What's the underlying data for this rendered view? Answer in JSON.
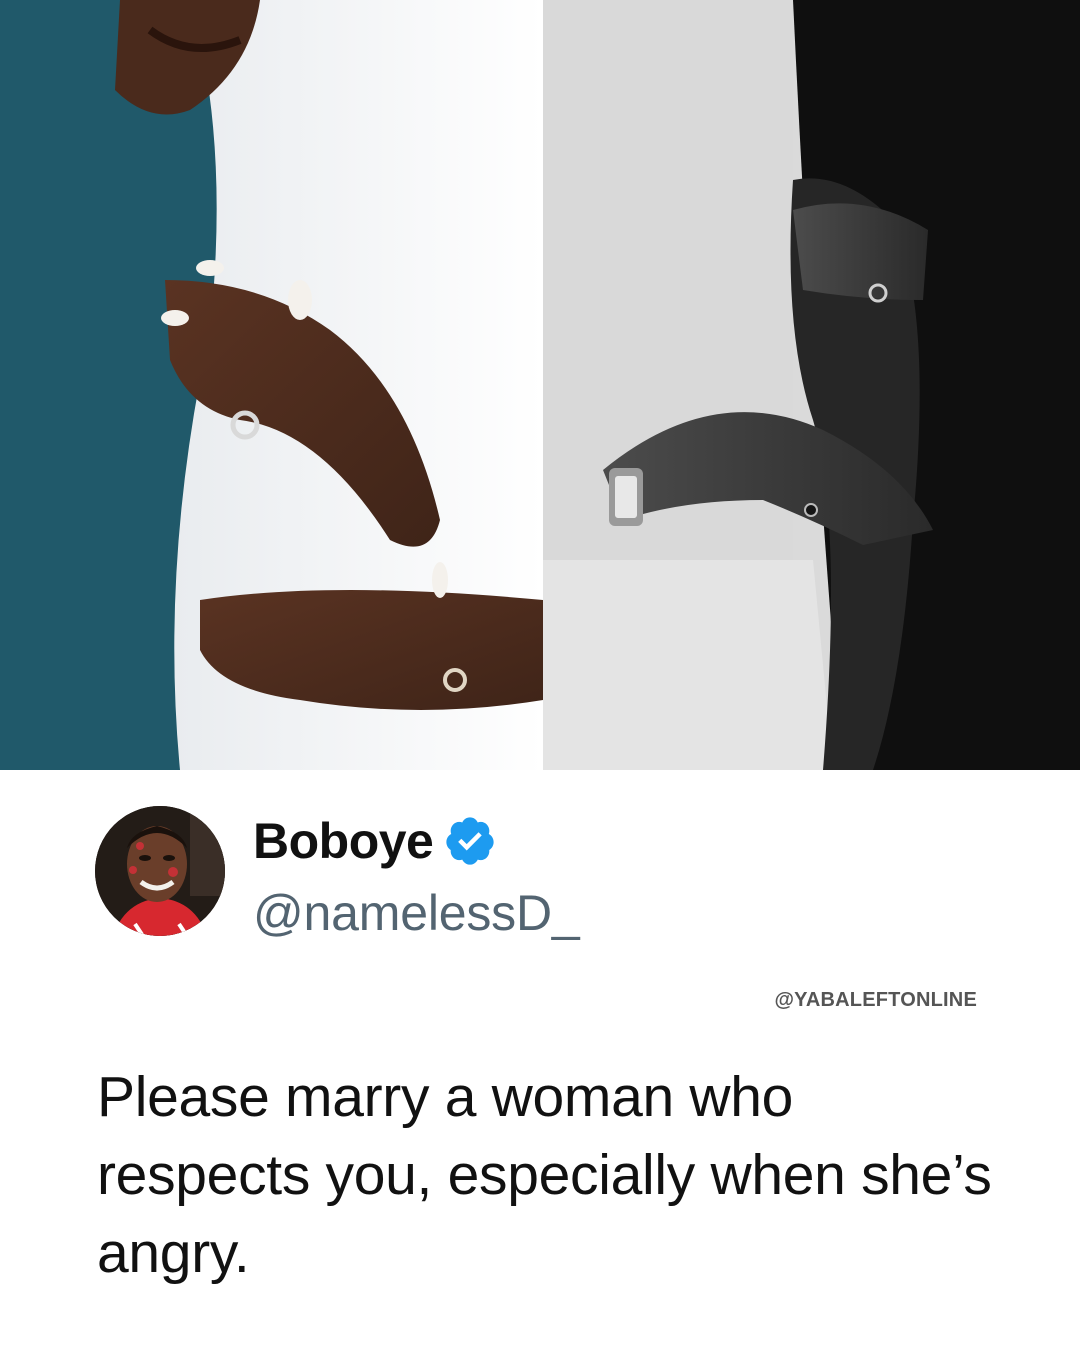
{
  "tweet": {
    "display_name": "Boboye",
    "handle": "@namelessD_",
    "verified": true,
    "verified_icon": "verified-badge-icon",
    "text": "Please marry a woman who respects you, especially when she’s angry."
  },
  "watermark": "@YABALEFTONLINE",
  "colors": {
    "verified_badge": "#1d9bf0",
    "handle_text": "#536471",
    "body_text": "#111111",
    "background": "#ffffff"
  }
}
